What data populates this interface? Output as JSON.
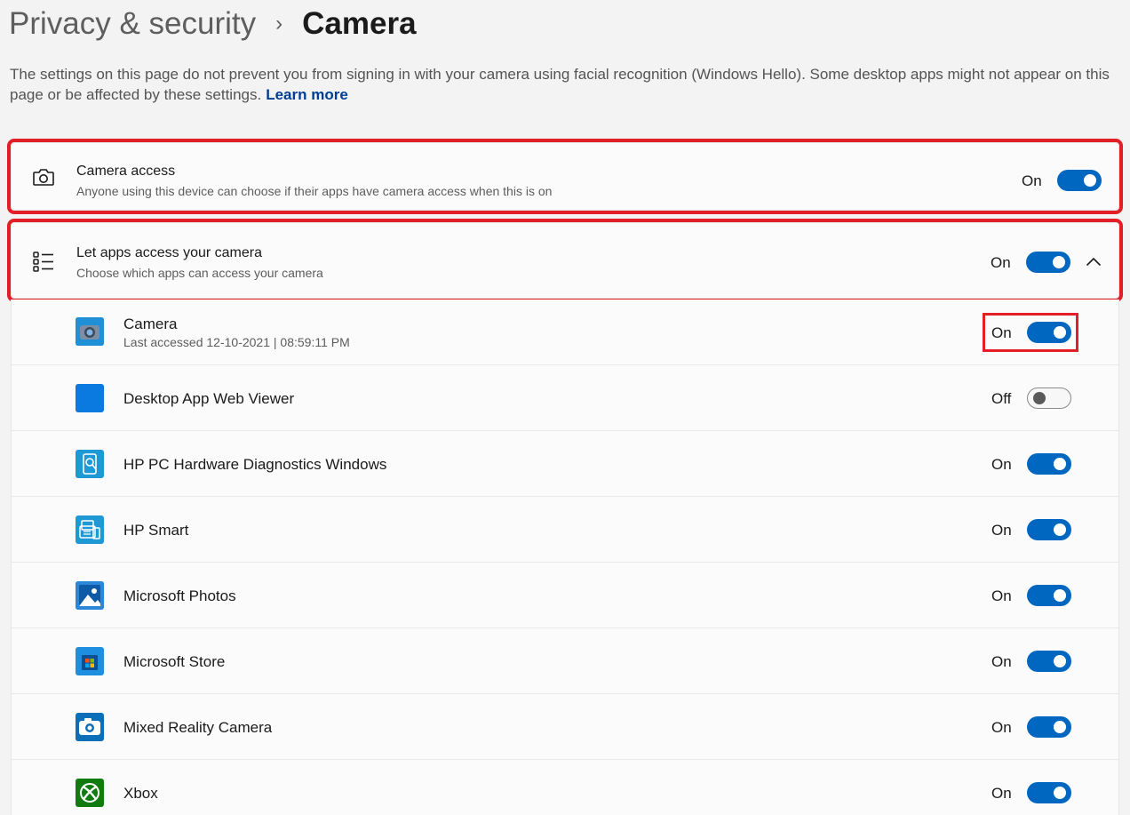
{
  "breadcrumb": {
    "parent": "Privacy & security",
    "separator": "›",
    "current": "Camera"
  },
  "description": {
    "text": "The settings on this page do not prevent you from signing in with your camera using facial recognition (Windows Hello). Some desktop apps might not appear on this page or be affected by these settings.",
    "link": "Learn more"
  },
  "camera_access": {
    "icon": "camera-icon",
    "title": "Camera access",
    "subtitle": "Anyone using this device can choose if their apps have camera access when this is on",
    "state": "On",
    "enabled": true
  },
  "let_apps": {
    "icon": "list-icon",
    "title": "Let apps access your camera",
    "subtitle": "Choose which apps can access your camera",
    "state": "On",
    "enabled": true,
    "expanded": true
  },
  "apps": [
    {
      "name": "Camera",
      "subtitle": "Last accessed 12-10-2021  |  08:59:11 PM",
      "state": "On",
      "enabled": true,
      "icon": "camera-app-icon"
    },
    {
      "name": "Desktop App Web Viewer",
      "subtitle": "",
      "state": "Off",
      "enabled": false,
      "icon": "blue-square-icon"
    },
    {
      "name": "HP PC Hardware Diagnostics Windows",
      "subtitle": "",
      "state": "On",
      "enabled": true,
      "icon": "hp-diagnostics-icon"
    },
    {
      "name": "HP Smart",
      "subtitle": "",
      "state": "On",
      "enabled": true,
      "icon": "hp-smart-icon"
    },
    {
      "name": "Microsoft Photos",
      "subtitle": "",
      "state": "On",
      "enabled": true,
      "icon": "photos-icon"
    },
    {
      "name": "Microsoft Store",
      "subtitle": "",
      "state": "On",
      "enabled": true,
      "icon": "store-icon"
    },
    {
      "name": "Mixed Reality Camera",
      "subtitle": "",
      "state": "On",
      "enabled": true,
      "icon": "mixed-reality-camera-icon"
    },
    {
      "name": "Xbox",
      "subtitle": "",
      "state": "On",
      "enabled": true,
      "icon": "xbox-icon"
    }
  ],
  "colors": {
    "accent": "#0067c0",
    "highlight": "#e21f26",
    "link": "#003e92"
  }
}
